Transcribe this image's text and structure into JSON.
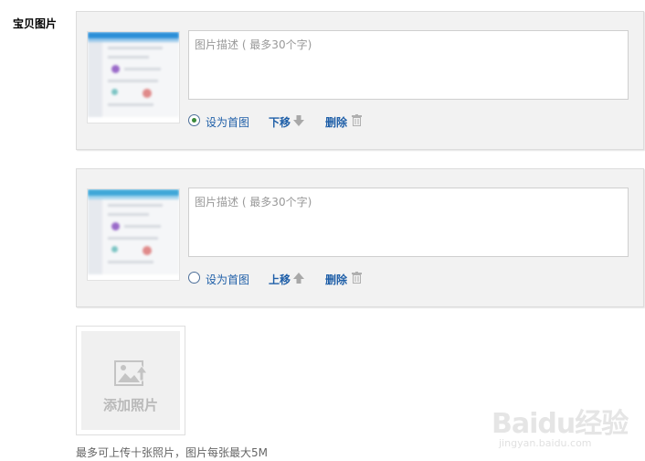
{
  "field_label": "宝贝图片",
  "cards": [
    {
      "description_placeholder": "图片描述 ( 最多30个字)",
      "set_cover_label": "设为首图",
      "set_cover_checked": true,
      "move_label": "下移",
      "move_icon": "arrow-down-icon",
      "delete_label": "删除",
      "delete_icon": "trash-icon"
    },
    {
      "description_placeholder": "图片描述 ( 最多30个字)",
      "set_cover_label": "设为首图",
      "set_cover_checked": false,
      "move_label": "上移",
      "move_icon": "arrow-up-icon",
      "delete_label": "删除",
      "delete_icon": "trash-icon"
    }
  ],
  "add_photo": {
    "label": "添加照片",
    "icon": "image-upload-icon"
  },
  "hint": "最多可上传十张照片，图片每张最大5M",
  "watermark": {
    "text": "Baidu经验",
    "url": "jingyan.baidu.com"
  },
  "colors": {
    "link": "#1f5fa8",
    "card_bg": "#f2f2f2",
    "radio_checked": "#3a8a3a"
  }
}
